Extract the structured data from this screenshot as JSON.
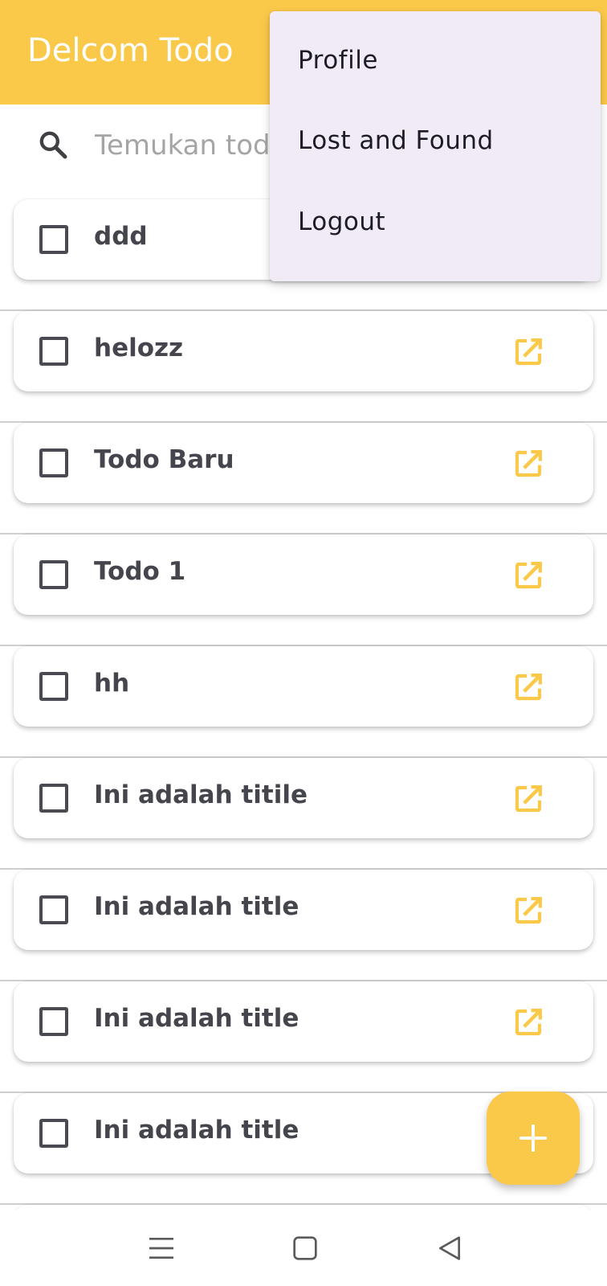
{
  "app_bar": {
    "title": "Delcom Todo",
    "background_color": "#fbc94a"
  },
  "search": {
    "icon": "search-icon",
    "placeholder": "Temukan todo..."
  },
  "todos": [
    {
      "title": "ddd",
      "checked": false,
      "edit_icon": "edit-icon"
    },
    {
      "title": "helozz",
      "checked": false,
      "edit_icon": "edit-icon"
    },
    {
      "title": "Todo Baru",
      "checked": false,
      "edit_icon": "edit-icon"
    },
    {
      "title": "Todo 1",
      "checked": false,
      "edit_icon": "edit-icon"
    },
    {
      "title": "hh",
      "checked": false,
      "edit_icon": "edit-icon"
    },
    {
      "title": "Ini adalah titile",
      "checked": false,
      "edit_icon": "edit-icon"
    },
    {
      "title": "Ini adalah title",
      "checked": false,
      "edit_icon": "edit-icon"
    },
    {
      "title": "Ini adalah title",
      "checked": false,
      "edit_icon": "edit-icon"
    },
    {
      "title": "Ini adalah title",
      "checked": false,
      "edit_icon": "edit-icon"
    }
  ],
  "menu": {
    "items": [
      "Profile",
      "Lost and Found",
      "Logout"
    ]
  },
  "fab": {
    "icon": "plus-icon",
    "color": "#fbc94a"
  },
  "nav_bar": {
    "buttons": [
      "menu-lines-icon",
      "home-square-icon",
      "back-triangle-icon"
    ]
  },
  "colors": {
    "accent": "#fbc94a",
    "title_text": "#45454d",
    "menu_bg": "#f0ebf5"
  }
}
